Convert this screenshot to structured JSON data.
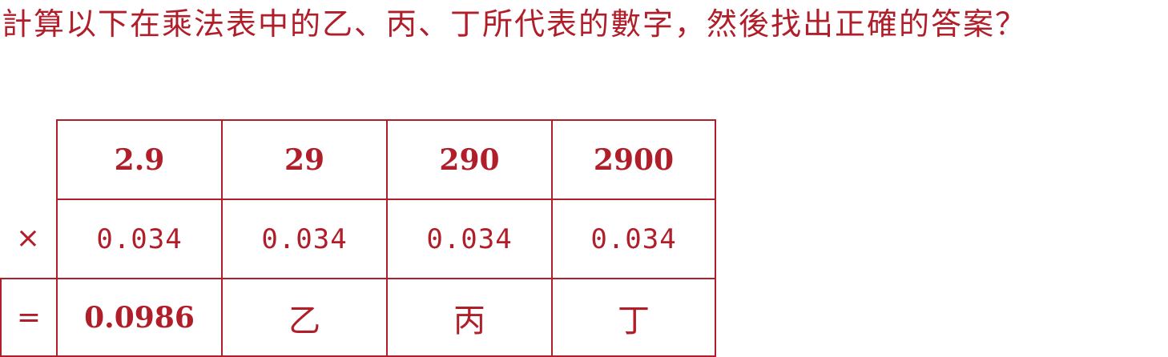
{
  "question": "計算以下在乘法表中的乙、丙、丁所代表的數字，然後找出正確的答案？",
  "table": {
    "top_row": [
      "2.9",
      "29",
      "290",
      "2900"
    ],
    "operator_times": "×",
    "middle_row": [
      "0.034",
      "0.034",
      "0.034",
      "0.034"
    ],
    "operator_equals": "=",
    "result_row": [
      "0.0986",
      "乙",
      "丙",
      "丁"
    ]
  },
  "colors": {
    "text": "#b01e2a",
    "border": "#b01e2a",
    "background": "#ffffff"
  }
}
